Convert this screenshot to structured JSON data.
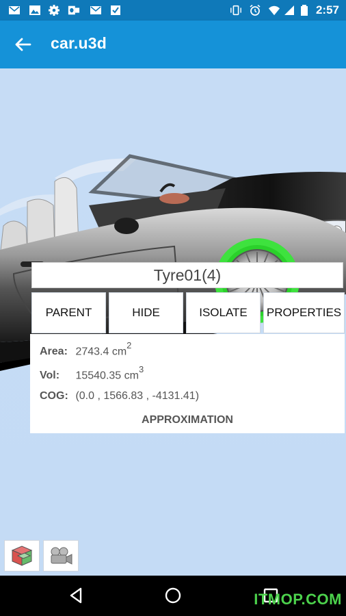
{
  "status_bar": {
    "time": "2:57",
    "left_icons": [
      "mail-icon",
      "image-icon",
      "gear-icon",
      "outlook-icon",
      "mail-icon",
      "check-box-icon"
    ],
    "right_icons": [
      "vibrate-icon",
      "alarm-icon",
      "wifi-icon",
      "signal-icon",
      "battery-icon"
    ]
  },
  "app_bar": {
    "title": "car.u3d",
    "back_icon": "back-arrow-icon"
  },
  "selection": {
    "name": "Tyre01(4)"
  },
  "actions": {
    "parent": "PARENT",
    "hide": "HIDE",
    "isolate": "ISOLATE",
    "properties": "PROPERTIES"
  },
  "info": {
    "area_label": "Area:",
    "area_value": "2743.4 cm",
    "area_exp": "2",
    "vol_label": "Vol:",
    "vol_value": "15540.35 cm",
    "vol_exp": "3",
    "cog_label": "COG:",
    "cog_value": "(0.0 , 1566.83 , -4131.41)",
    "approx_label": "APPROXIMATION"
  },
  "tools": [
    "cube-view-icon",
    "camera-icon"
  ],
  "nav_bar": [
    "back-triangle-icon",
    "home-circle-icon",
    "recents-square-icon"
  ],
  "watermark": "ITMOP.COM",
  "colors": {
    "status_bar": "#0f79b9",
    "app_bar": "#1592d8",
    "viewport_bg": "#c6dcf5",
    "highlight": "#3ee23e"
  }
}
